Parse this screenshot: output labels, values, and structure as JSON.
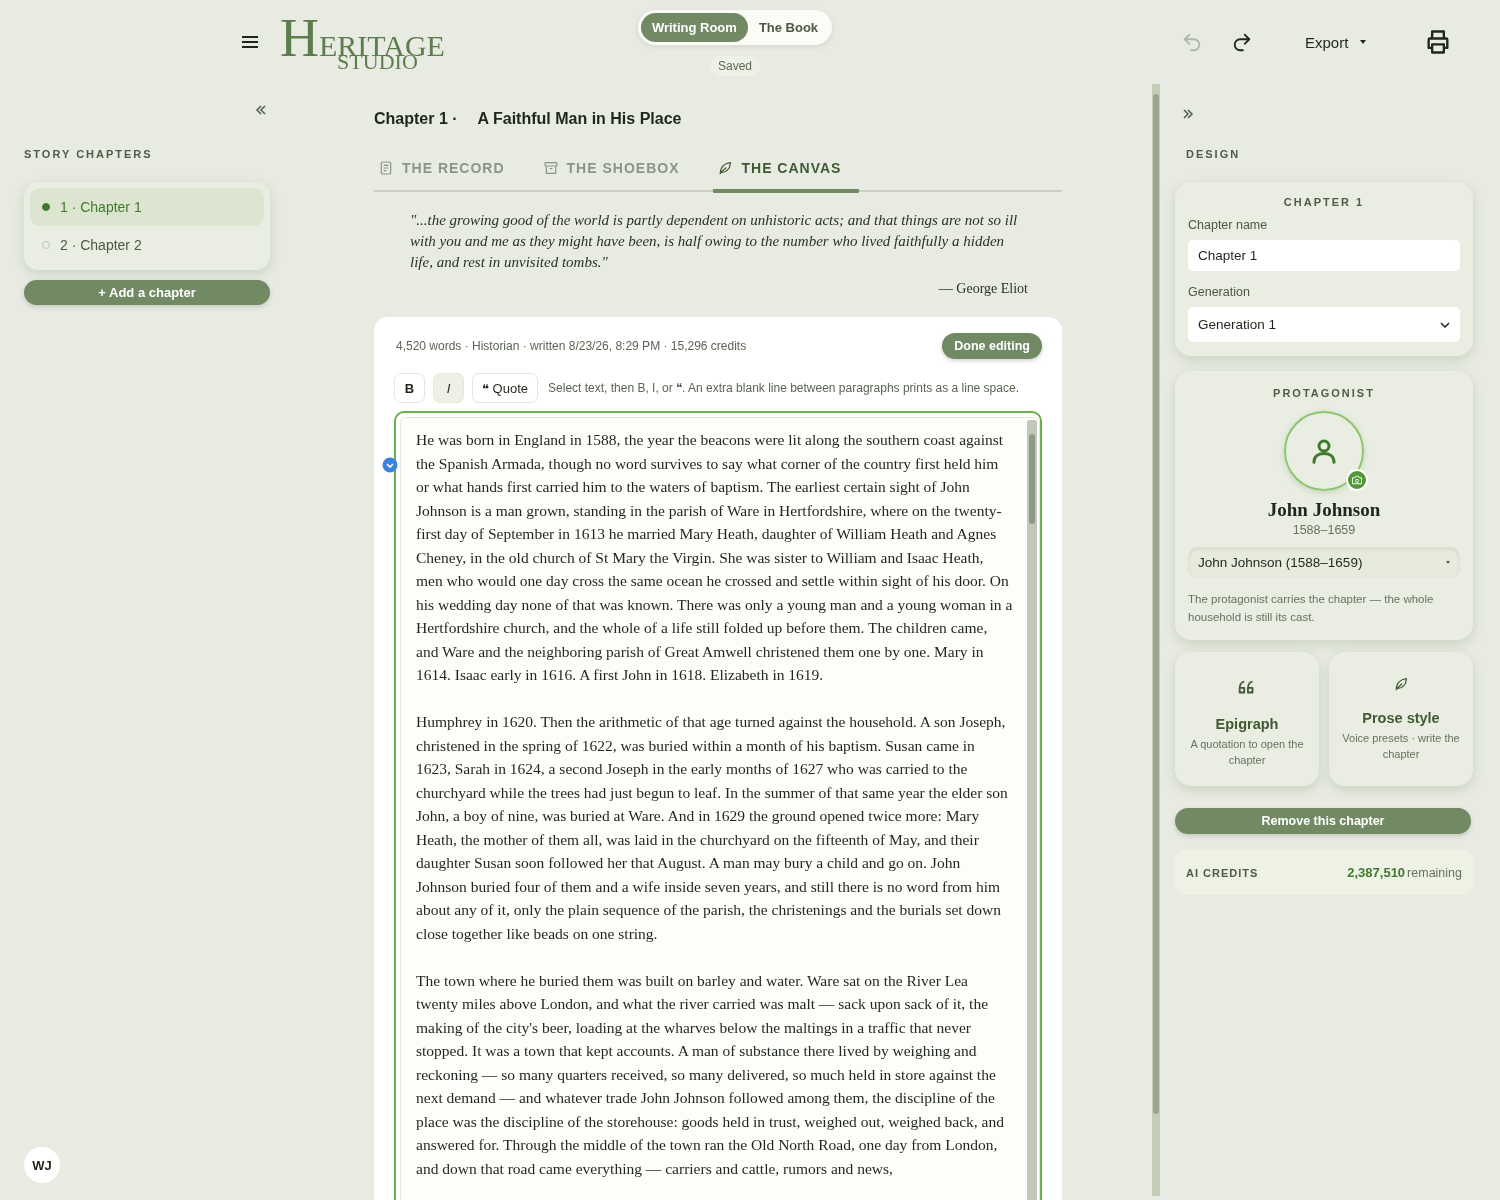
{
  "header": {
    "logo": {
      "title": "HERITAGE",
      "subtitle": "STUDIO"
    },
    "modes": [
      {
        "label": "Writing Room",
        "selected": true
      },
      {
        "label": "The Book",
        "selected": false
      }
    ],
    "save_status": "Saved",
    "undo": {
      "disabled": true
    },
    "redo": {
      "disabled": false
    },
    "export": "Export"
  },
  "sidebar": {
    "title": "STORY CHAPTERS",
    "chapters": [
      {
        "label": "1 · Chapter 1",
        "selected": true
      },
      {
        "label": "2 · Chapter 2",
        "selected": false
      }
    ],
    "add_button": "+ Add a chapter",
    "user_avatar": "WJ"
  },
  "chapter_heading": {
    "number": "Chapter 1 ·",
    "title": "A Faithful Man in His Place"
  },
  "tabs": [
    {
      "label": "THE RECORD",
      "selected": false
    },
    {
      "label": "THE SHOEBOX",
      "selected": false
    },
    {
      "label": "THE CANVAS",
      "selected": true
    }
  ],
  "epigraph": {
    "quote": "\"...the growing good of the world is partly dependent on unhistoric acts; and that things are not so ill with you and me as they might have been, is half owing to the number who lived faithfully a hidden life, and rest in unvisited tombs.\"",
    "attribution": "— George Eliot"
  },
  "editor": {
    "meta": "4,520 words · Historian · written 8/23/26, 8:29 PM · 15,296 credits",
    "done_button": "Done editing",
    "format_buttons": [
      {
        "label": "B",
        "kind": "bold",
        "pressed": false
      },
      {
        "label": "I",
        "kind": "italic",
        "pressed": true
      },
      {
        "label": "❝ Quote",
        "kind": "quote",
        "pressed": false
      }
    ],
    "hint": "Select text, then B, I, or ❝. An extra blank line between paragraphs prints as a line space.",
    "paragraphs": [
      "He was born in England in 1588, the year the beacons were lit along the southern coast against the Spanish Armada, though no word survives to say what corner of the country first held him or what hands first carried him to the waters of baptism. The earliest certain sight of John Johnson is a man grown, standing in the parish of Ware in Hertfordshire, where on the twenty-first day of September in 1613 he married Mary Heath, daughter of William Heath and Agnes Cheney, in the old church of St Mary the Virgin. She was sister to William and Isaac Heath, men who would one day cross the same ocean he crossed and settle within sight of his door. On his wedding day none of that was known. There was only a young man and a young woman in a Hertfordshire church, and the whole of a life still folded up before them. The children came, and Ware and the neighboring parish of Great Amwell christened them one by one. Mary in 1614. Isaac early in 1616. A first John in 1618. Elizabeth in 1619.",
      "Humphrey in 1620. Then the arithmetic of that age turned against the household. A son Joseph, christened in the spring of 1622, was buried within a month of his baptism. Susan came in 1623, Sarah in 1624, a second Joseph in the early months of 1627 who was carried to the churchyard while the trees had just begun to leaf. In the summer of that same year the elder son John, a boy of nine, was buried at Ware. And in 1629 the ground opened twice more: Mary Heath, the mother of them all, was laid in the churchyard on the fifteenth of May, and their daughter Susan soon followed her that August. A man may bury a child and go on. John Johnson buried four of them and a wife inside seven years, and still there is no word from him about any of it, only the plain sequence of the parish, the christenings and the burials set down close together like beads on one string.",
      "The town where he buried them was built on barley and water. Ware sat on the River Lea twenty miles above London, and what the river carried was malt — sack upon sack of it, the making of the city's beer, loading at the wharves below the maltings in a traffic that never stopped. It was a town that kept accounts. A man of substance there lived by weighing and reckoning — so many quarters received, so many delivered, so much held in store against the next demand — and whatever trade John Johnson followed among them, the discipline of the place was the discipline of the storehouse: goods held in trust, weighed out, weighed back, and answered for. Through the middle of the town ran the Old North Road, one day from London, and down that road came everything — carriers and cattle, rumors and news,"
    ]
  },
  "design": {
    "title": "DESIGN",
    "chapter_card": {
      "heading": "CHAPTER 1",
      "name_label": "Chapter name",
      "name_value": "Chapter 1",
      "generation_label": "Generation",
      "generation_value": "Generation 1"
    },
    "protagonist": {
      "heading": "PROTAGONIST",
      "name": "John Johnson",
      "dates": "1588–1659",
      "select_value": "John Johnson (1588–1659)",
      "note": "The protagonist carries the chapter — the whole household is still its cast."
    },
    "tools": [
      {
        "title": "Epigraph",
        "description": "A quotation to open the chapter"
      },
      {
        "title": "Prose style",
        "description": "Voice presets · write the chapter"
      }
    ],
    "remove_button": "Remove this chapter",
    "credits": {
      "label": "AI CREDITS",
      "amount": "2,387,510",
      "suffix": "remaining"
    }
  }
}
